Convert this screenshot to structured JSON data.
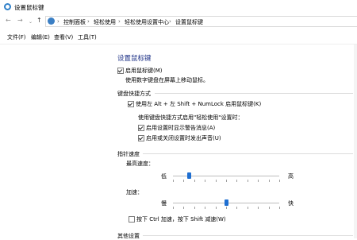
{
  "window": {
    "title": "设置鼠标键"
  },
  "nav": {
    "back": "←",
    "forward": "→",
    "recent": "⌄",
    "up": "↑",
    "separator": "›",
    "breadcrumbs": [
      "控制面板",
      "轻松使用",
      "轻松使用设置中心",
      "设置鼠标键"
    ]
  },
  "menu": [
    "文件(F)",
    "编辑(E)",
    "查看(V)",
    "工具(T)"
  ],
  "main": {
    "title": "设置鼠标键",
    "enable_mousekeys": {
      "label": "启用鼠标键(M)",
      "checked": true
    },
    "enable_desc": "使用数字键盘在屏幕上移动鼠标。",
    "shortcut_section": "键盘快捷方式",
    "shortcut_toggle": {
      "label": "使用左 Alt + 左 Shift + NumLock 启用鼠标键(K)",
      "checked": true
    },
    "shortcut_note": "使用键盘快捷方式启用\"轻松使用\"设置时：",
    "show_warning": {
      "label": "启用设置时显示警告消息(A)",
      "checked": true
    },
    "play_sound": {
      "label": "启用或关闭设置时发出声音(U)",
      "checked": true
    },
    "speed_section": "指针速度",
    "top_speed": {
      "label": "最高速度：",
      "min_label": "低",
      "max_label": "高",
      "level": 0.15
    },
    "acceleration": {
      "label": "加速：",
      "min_label": "慢",
      "max_label": "快",
      "level": 0.5
    },
    "ctrl_shift": {
      "label": "按下 Ctrl 加速，按下 Shift 减速(W)",
      "checked": false
    },
    "other_section": "其他设置"
  },
  "colors": {
    "title_blue": "#1e3287",
    "thumb_blue": "#1f6fd1"
  }
}
